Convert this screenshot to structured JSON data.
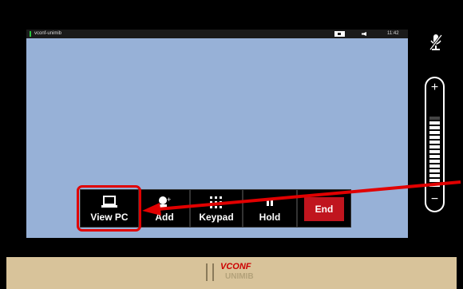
{
  "status_bar": {
    "site_name": "vconf-unimib",
    "time": "11:42"
  },
  "controls": {
    "view_pc": "View PC",
    "add": "Add",
    "keypad": "Keypad",
    "hold": "Hold",
    "end": "End"
  },
  "volume": {
    "plus": "+",
    "minus": "−",
    "level_fraction": 0.9
  },
  "logo": {
    "line1": "VCONF",
    "line2": "UNIMIB"
  },
  "colors": {
    "screen": "#97b1d7",
    "end_button": "#c0151e",
    "highlight": "#e10000",
    "banner": "#d8c39a"
  }
}
